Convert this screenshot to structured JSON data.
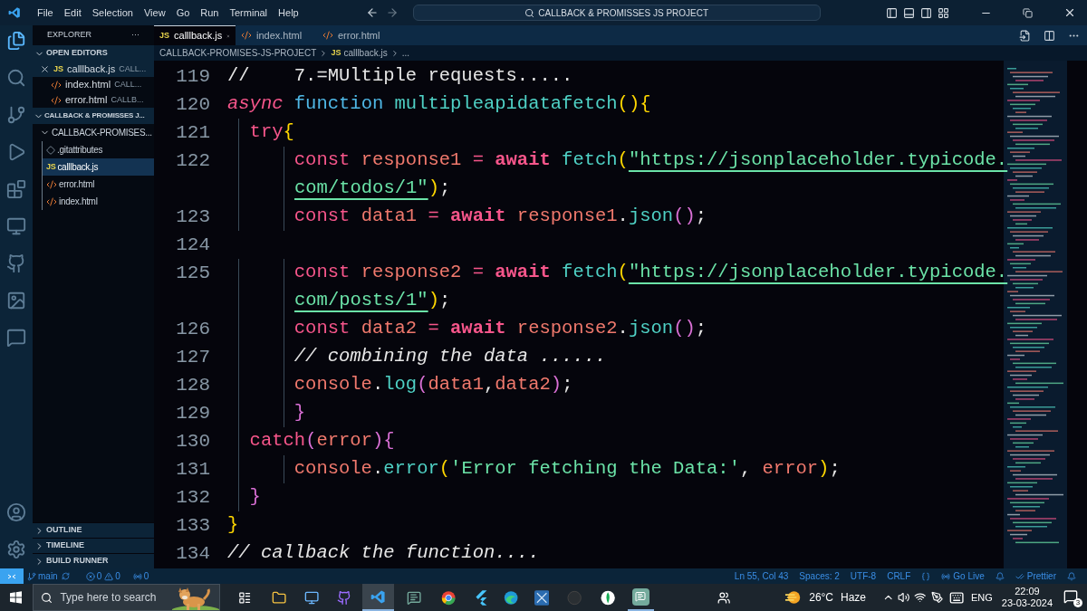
{
  "menu": [
    "File",
    "Edit",
    "Selection",
    "View",
    "Go",
    "Run",
    "Terminal",
    "Help"
  ],
  "command_center": "CALLBACK & PROMISSES JS PROJECT",
  "sidebar": {
    "title": "EXPLORER",
    "more": "···",
    "open_editors": {
      "label": "OPEN EDITORS",
      "expanded": true,
      "items": [
        {
          "name": "calllback.js",
          "path": "CALL...",
          "kind": "js",
          "icon_text": "JS",
          "selected": true
        },
        {
          "name": "index.html",
          "path": "CALL...",
          "kind": "html",
          "selected": false
        },
        {
          "name": "error.html",
          "path": "CALLB...",
          "kind": "html",
          "selected": false
        }
      ]
    },
    "workspace": {
      "label": "CALLBACK & PROMISSES J...",
      "expanded": true,
      "children": [
        {
          "name": "CALLBACK-PROMISES...",
          "kind": "folder",
          "expanded": true,
          "selected": false,
          "children": [
            {
              "name": ".gitattributes",
              "kind": "git",
              "selected": false
            },
            {
              "name": "calllback.js",
              "kind": "js",
              "icon_text": "JS",
              "selected": true
            },
            {
              "name": "error.html",
              "kind": "html",
              "selected": false
            },
            {
              "name": "index.html",
              "kind": "html",
              "selected": false
            }
          ]
        }
      ]
    },
    "panels": [
      {
        "label": "OUTLINE",
        "expanded": false
      },
      {
        "label": "TIMELINE",
        "expanded": false
      },
      {
        "label": "BUILD RUNNER",
        "expanded": false
      }
    ]
  },
  "tabs": [
    {
      "label": "calllback.js",
      "kind": "js",
      "icon_text": "JS",
      "selected": true
    },
    {
      "label": "index.html",
      "kind": "html",
      "selected": false
    },
    {
      "label": "error.html",
      "kind": "html",
      "selected": false
    }
  ],
  "breadcrumb": [
    {
      "label": "CALLBACK-PROMISES-JS-PROJECT"
    },
    {
      "label": "calllback.js",
      "kind": "js",
      "icon_text": "JS"
    },
    {
      "label": "..."
    }
  ],
  "code": [
    {
      "number": "119",
      "tokens": [
        {
          "text": "//    7.=MUltiple requests.....",
          "kind": "plain"
        }
      ]
    },
    {
      "number": "120",
      "tokens": [
        {
          "text": "async",
          "kind": "modifier"
        },
        {
          "text": " function",
          "kind": "storage"
        },
        {
          "text": " multipleapidatafetch",
          "kind": "func"
        },
        {
          "text": "(){",
          "kind": "bracket"
        }
      ]
    },
    {
      "number": "121",
      "tokens": [
        {
          "text": "  try",
          "kind": "keyword"
        },
        {
          "text": "{",
          "kind": "bracket"
        }
      ]
    },
    {
      "number": "122",
      "tokens": [
        {
          "text": "      const",
          "kind": "keyword"
        },
        {
          "text": " response1",
          "kind": "var"
        },
        {
          "text": " =",
          "kind": "keyword"
        },
        {
          "text": " await",
          "kind": "await"
        },
        {
          "text": " fetch",
          "kind": "func"
        },
        {
          "text": "(",
          "kind": "bracket"
        },
        {
          "text": "\"https://jsonplaceholder.typicode.",
          "kind": "url"
        }
      ]
    },
    {
      "wrapped": true,
      "tokens": [
        {
          "text": "com/todos/1\"",
          "kind": "url"
        },
        {
          "text": ")",
          "kind": "bracket"
        },
        {
          "text": ";",
          "kind": "plain"
        }
      ]
    },
    {
      "number": "123",
      "tokens": [
        {
          "text": "      const",
          "kind": "keyword"
        },
        {
          "text": " data1",
          "kind": "var"
        },
        {
          "text": " =",
          "kind": "keyword"
        },
        {
          "text": " await",
          "kind": "await"
        },
        {
          "text": " response1",
          "kind": "var"
        },
        {
          "text": ".",
          "kind": "plain"
        },
        {
          "text": "json",
          "kind": "func"
        },
        {
          "text": "()",
          "kind": "bracket2"
        },
        {
          "text": ";",
          "kind": "plain"
        }
      ]
    },
    {
      "number": "124"
    },
    {
      "number": "125",
      "tokens": [
        {
          "text": "      const",
          "kind": "keyword"
        },
        {
          "text": " response2",
          "kind": "var"
        },
        {
          "text": " =",
          "kind": "keyword"
        },
        {
          "text": " await",
          "kind": "await"
        },
        {
          "text": " fetch",
          "kind": "func"
        },
        {
          "text": "(",
          "kind": "bracket"
        },
        {
          "text": "\"https://jsonplaceholder.typicode.",
          "kind": "url"
        }
      ]
    },
    {
      "wrapped": true,
      "tokens": [
        {
          "text": "com/posts/1\"",
          "kind": "url"
        },
        {
          "text": ")",
          "kind": "bracket"
        },
        {
          "text": ";",
          "kind": "plain"
        }
      ]
    },
    {
      "number": "126",
      "tokens": [
        {
          "text": "      const",
          "kind": "keyword"
        },
        {
          "text": " data2",
          "kind": "var"
        },
        {
          "text": " =",
          "kind": "keyword"
        },
        {
          "text": " await",
          "kind": "await"
        },
        {
          "text": " response2",
          "kind": "var"
        },
        {
          "text": ".",
          "kind": "plain"
        },
        {
          "text": "json",
          "kind": "func"
        },
        {
          "text": "()",
          "kind": "bracket2"
        },
        {
          "text": ";",
          "kind": "plain"
        }
      ]
    },
    {
      "number": "127",
      "tokens": [
        {
          "text": "      // combining the data ......",
          "kind": "comment"
        }
      ]
    },
    {
      "number": "128",
      "tokens": [
        {
          "text": "      console",
          "kind": "var"
        },
        {
          "text": ".",
          "kind": "plain"
        },
        {
          "text": "log",
          "kind": "func"
        },
        {
          "text": "(",
          "kind": "bracket2"
        },
        {
          "text": "data1",
          "kind": "var"
        },
        {
          "text": ",",
          "kind": "plain"
        },
        {
          "text": "data2",
          "kind": "var"
        },
        {
          "text": ")",
          "kind": "bracket2"
        },
        {
          "text": ";",
          "kind": "plain"
        }
      ]
    },
    {
      "number": "129",
      "tokens": [
        {
          "text": "      }",
          "kind": "bracket2"
        }
      ]
    },
    {
      "number": "130",
      "tokens": [
        {
          "text": "  catch",
          "kind": "keyword"
        },
        {
          "text": "(",
          "kind": "bracket2"
        },
        {
          "text": "error",
          "kind": "var"
        },
        {
          "text": "){",
          "kind": "bracket2"
        }
      ]
    },
    {
      "number": "131",
      "tokens": [
        {
          "text": "      console",
          "kind": "var"
        },
        {
          "text": ".",
          "kind": "plain"
        },
        {
          "text": "error",
          "kind": "func"
        },
        {
          "text": "(",
          "kind": "bracket"
        },
        {
          "text": "'Error fetching the Data:'",
          "kind": "string"
        },
        {
          "text": ",",
          "kind": "plain"
        },
        {
          "text": " error",
          "kind": "var"
        },
        {
          "text": ")",
          "kind": "bracket"
        },
        {
          "text": ";",
          "kind": "plain"
        }
      ]
    },
    {
      "number": "132",
      "tokens": [
        {
          "text": "  }",
          "kind": "bracket2"
        }
      ]
    },
    {
      "number": "133",
      "tokens": [
        {
          "text": "}",
          "kind": "bracket"
        }
      ]
    },
    {
      "number": "134",
      "tokens": [
        {
          "text": "// callback the function....",
          "kind": "comment"
        }
      ]
    }
  ],
  "status_bar": {
    "branch": "main",
    "errors": "0",
    "warnings": "0",
    "ports": "0",
    "right": [
      "Ln 55, Col 43",
      "Spaces: 2",
      "UTF-8",
      "CRLF"
    ],
    "go_live": "Go Live",
    "prettier": "Prettier"
  },
  "taskbar": {
    "search_placeholder": "Type here to search",
    "weather": "26°C",
    "condition": "Haze",
    "language": "ENG",
    "time": "22:09",
    "date": "23-03-2024",
    "notifications": "3"
  }
}
